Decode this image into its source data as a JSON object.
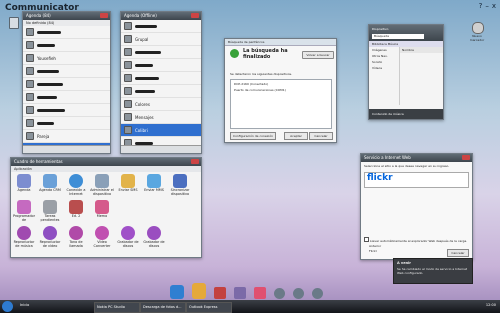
{
  "app": {
    "title": "Communicator",
    "controls": [
      "?",
      "–",
      "x"
    ],
    "right_labels": [
      "Nuevo marcador",
      "Llamada telefónica"
    ]
  },
  "contacts": {
    "title": "Agenda (84)",
    "group": "No definido (84)",
    "items": [
      "Contacto",
      "Contacto",
      "Yousefieh",
      "Contacto",
      "Contacto",
      "Contacto",
      "Contacto",
      "Contacto",
      "Contacto",
      "Pareja",
      "Contacto"
    ]
  },
  "contacts2": {
    "title": "Agenda (Offline)",
    "items": [
      "Contacto",
      "Grupal",
      "Contacto",
      "Contacto",
      "Contacto",
      "Contacto",
      "Contacto",
      "Contacto",
      "Colores",
      "Mensajes",
      "Colibri",
      "Contacto"
    ]
  },
  "search_dialog": {
    "title": "Búsqueda de periféricos",
    "heading": "La búsqueda ha finalizado",
    "body": "Se detectaron los siguientes dispositivos.",
    "button_search": "Volver a buscar",
    "items": [
      "DCP-2160 (Conectado)",
      "Puerto de comunicaciones (COM1)"
    ],
    "config_button": "Configuración de conexión",
    "accept": "Aceptar",
    "cancel": "Cancelar"
  },
  "media": {
    "title": "Dispositivo",
    "search": "Búsqueda",
    "folder": "Biblioteca Música",
    "table_header": "Nombre",
    "tree": [
      "Imágenes",
      "Otros Nav.",
      "Sonido",
      "Vídeos"
    ],
    "ad": "Contenido de música"
  },
  "toolbox": {
    "title": "Cuadro de herramientas",
    "section": "Aplicación",
    "row1": [
      "Agenda",
      "Agenda CRM",
      "Conexión a Internet",
      "Administrar el dispositivo",
      "Enviar SMS",
      "Enviar MMS",
      "Sincronizar dispositivo"
    ],
    "row2": [
      "Programador de",
      "Tareas pendientes",
      "Ed. 2",
      "Memo"
    ],
    "row3": [
      "Reproductor de música",
      "Reproductor de vídeo",
      "Tono de llamada",
      "Vídeo Converter",
      "Grabador de discos",
      "Grabador de discos"
    ]
  },
  "flickr": {
    "title": "Servicio a Internet Web",
    "text": "Seleccione el sitio a la que desee navegar en su ingreso.",
    "logo": "flickr",
    "check_label": "Llevar automáticamente al explorador Web después de la carga.",
    "options": [
      "Anterior",
      "Flickr"
    ],
    "cancel": "Cancelar"
  },
  "tooltip": {
    "title": "A venir",
    "text": "Se ha cambiado el modo de servicio a Internet Web configurado."
  },
  "dock": {
    "labels": [
      "Servicio",
      "Comunicaciones",
      "Dispositivos",
      "Descargas",
      "Herramientas",
      "Llamadas",
      "Mensajes",
      "Red"
    ]
  },
  "taskbar": {
    "start": "Inicio",
    "tabs": [
      "Nokia PC Studio",
      "Descarga de fotos d...",
      "Outlook Express"
    ],
    "time": "12:00"
  },
  "colors": {
    "accent": "#3a7bd5",
    "dark": "#4a5158",
    "selection": "#2f6fcf"
  }
}
